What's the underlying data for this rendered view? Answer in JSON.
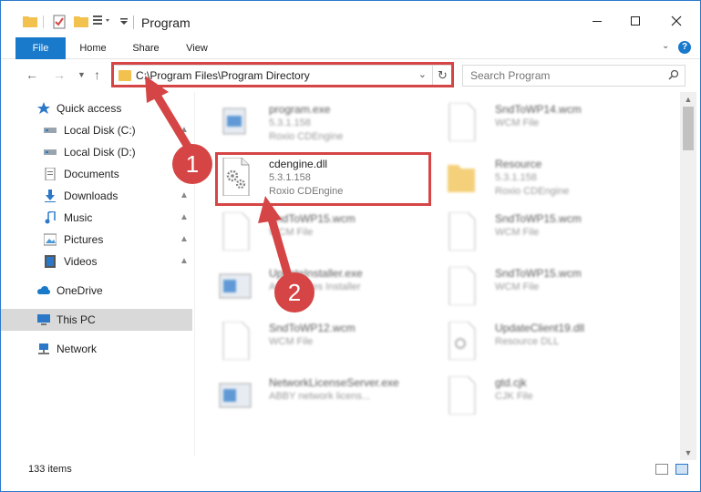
{
  "window": {
    "title": "Program"
  },
  "ribbon": {
    "tabs": [
      {
        "label": "File"
      },
      {
        "label": "Home"
      },
      {
        "label": "Share"
      },
      {
        "label": "View"
      }
    ]
  },
  "address": {
    "path": "C:\\Program Files\\Program Directory"
  },
  "search": {
    "placeholder": "Search Program"
  },
  "sidebar": {
    "items": [
      {
        "label": "Quick access",
        "icon": "star-icon"
      },
      {
        "label": "Local Disk (C:)",
        "icon": "drive-icon"
      },
      {
        "label": "Local Disk (D:)",
        "icon": "drive-icon"
      },
      {
        "label": "Documents",
        "icon": "documents-icon"
      },
      {
        "label": "Downloads",
        "icon": "download-icon"
      },
      {
        "label": "Music",
        "icon": "music-icon"
      },
      {
        "label": "Pictures",
        "icon": "pictures-icon"
      },
      {
        "label": "Videos",
        "icon": "videos-icon"
      },
      {
        "label": "OneDrive",
        "icon": "cloud-icon"
      },
      {
        "label": "This PC",
        "icon": "computer-icon"
      },
      {
        "label": "Network",
        "icon": "network-icon"
      }
    ]
  },
  "files": [
    {
      "name": "program.exe",
      "version": "5.3.1.158",
      "desc": "Roxio CDEngine"
    },
    {
      "name": "SndToWP14.wcm",
      "version": "WCM File",
      "desc": ""
    },
    {
      "name": "cdengine.dll",
      "version": "5.3.1.158",
      "desc": "Roxio CDEngine"
    },
    {
      "name": "Resource",
      "version": "5.3.1.158",
      "desc": "Roxio CDEngine"
    },
    {
      "name": "SndToWP15.wcm",
      "version": "WCM File",
      "desc": ""
    },
    {
      "name": "SndToWP15.wcm",
      "version": "WCM File",
      "desc": ""
    },
    {
      "name": "UpdateInstaller.exe",
      "version": "Avi Updates Installer",
      "desc": ""
    },
    {
      "name": "SndToWP15.wcm",
      "version": "WCM File",
      "desc": ""
    },
    {
      "name": "SndToWP12.wcm",
      "version": "WCM File",
      "desc": ""
    },
    {
      "name": "UpdateClient19.dll",
      "version": "Resource DLL",
      "desc": ""
    },
    {
      "name": "NetworkLicenseServer.exe",
      "version": "ABBY network licens...",
      "desc": ""
    },
    {
      "name": "gtd.cjk",
      "version": "CJK File",
      "desc": ""
    }
  ],
  "status": {
    "count": "133 items"
  },
  "callouts": [
    "1",
    "2"
  ]
}
